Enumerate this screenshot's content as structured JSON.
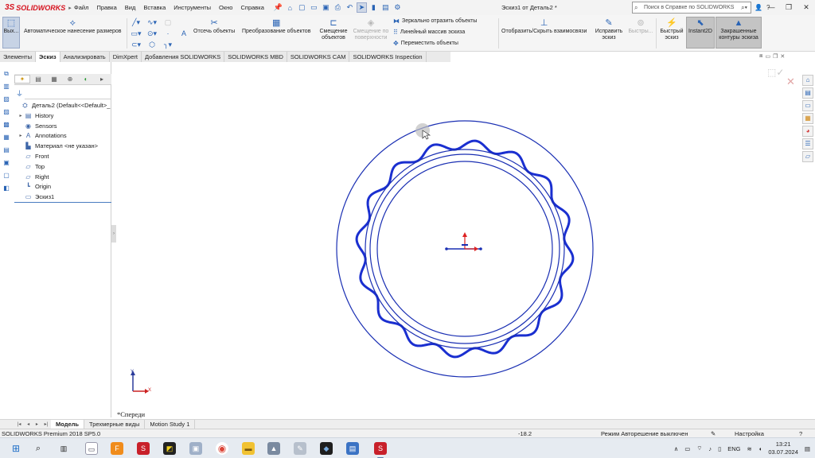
{
  "app": {
    "brand": "SOLIDWORKS",
    "document_title": "Эскиз1 от Деталь2 *",
    "menu": [
      "Файл",
      "Правка",
      "Вид",
      "Вставка",
      "Инструменты",
      "Окно",
      "Справка"
    ],
    "help_search_placeholder": "Поиск в Справке по SOLIDWORKS"
  },
  "command_manager": {
    "exit_sketch": "Вых...",
    "smart_dimension": "Автоматическое нанесение размеров",
    "trim": "Отсечь объекты",
    "convert": "Преобразование объектов",
    "offset": "Смещение объектов",
    "offset_on_surface": "Смещение по поверхности",
    "mirror": "Зеркально отразить объекты",
    "linear_pattern": "Линейный массив эскиза",
    "move": "Переместить объекты",
    "display_relations": "Отобразить/Скрыть взаимосвязи",
    "repair_sketch": "Исправить эскиз",
    "quick_snaps_disabled": "Быстры...",
    "quick_snaps": "Быстрый эскиз",
    "instant2d": "Instant2D",
    "shaded_contours": "Закрашенные контуры эскиза"
  },
  "tabs": [
    "Элементы",
    "Эскиз",
    "Анализировать",
    "DimXpert",
    "Добавления SOLIDWORKS",
    "SOLIDWORKS MBD",
    "SOLIDWORKS CAM",
    "SOLIDWORKS Inspection"
  ],
  "active_tab_index": 1,
  "feature_tree": [
    {
      "label": "Деталь2  (Default<<Default>_",
      "icon": "part-icon",
      "expand": ""
    },
    {
      "label": "History",
      "icon": "history-icon",
      "expand": "▸"
    },
    {
      "label": "Sensors",
      "icon": "sensors-icon",
      "expand": ""
    },
    {
      "label": "Annotations",
      "icon": "annotations-icon",
      "expand": "▸"
    },
    {
      "label": "Материал <не указан>",
      "icon": "material-icon",
      "expand": ""
    },
    {
      "label": "Front",
      "icon": "plane-icon",
      "expand": ""
    },
    {
      "label": "Top",
      "icon": "plane-icon",
      "expand": ""
    },
    {
      "label": "Right",
      "icon": "plane-icon",
      "expand": ""
    },
    {
      "label": "Origin",
      "icon": "origin-icon",
      "expand": ""
    },
    {
      "label": "Эскиз1",
      "icon": "sketch-icon",
      "expand": ""
    }
  ],
  "viewport": {
    "view_name": "*Спереди",
    "triad_x": "X",
    "triad_y": "Y"
  },
  "model_tabs": [
    "Модель",
    "Трехмерные виды",
    "Motion Study 1"
  ],
  "active_model_tab": 0,
  "status": {
    "product": "SOLIDWORKS Premium 2018 SP5.0",
    "coordinate": "-18.2",
    "mode": "Режим Авторешение выключен",
    "settings": "Настройка"
  },
  "taskbar": {
    "lang": "ENG",
    "time": "13:21",
    "date": "03.07.2024"
  },
  "colors": {
    "sketch_blue": "#1a2fb3",
    "sketch_bold": "#1a2fd0",
    "brand_red": "#d6111d"
  }
}
